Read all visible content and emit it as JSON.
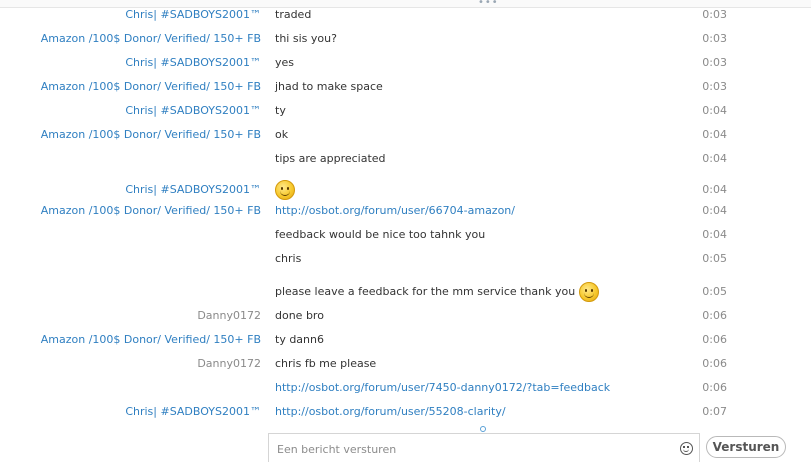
{
  "messages": [
    {
      "sender": "Chris| #SADBOYS2001™",
      "sender_style": "blue",
      "text": "traded",
      "time": "0:03"
    },
    {
      "sender": "Amazon /100$ Donor/ Verified/ 150+ FB",
      "sender_style": "blue",
      "text": "thi sis you?",
      "time": "0:03"
    },
    {
      "sender": "Chris| #SADBOYS2001™",
      "sender_style": "blue",
      "text": "yes",
      "time": "0:03"
    },
    {
      "sender": "Amazon /100$ Donor/ Verified/ 150+ FB",
      "sender_style": "blue",
      "text": "jhad to make space",
      "time": "0:03"
    },
    {
      "sender": "Chris| #SADBOYS2001™",
      "sender_style": "blue",
      "text": "ty",
      "time": "0:04"
    },
    {
      "sender": "Amazon /100$ Donor/ Verified/ 150+ FB",
      "sender_style": "blue",
      "text": "ok",
      "time": "0:04"
    },
    {
      "sender": "",
      "sender_style": "blue",
      "text": "tips are appreciated",
      "time": "0:04"
    },
    {
      "sender": "Chris| #SADBOYS2001™",
      "sender_style": "blue",
      "text": "",
      "emoji": "smile-emoji",
      "time": "0:04"
    },
    {
      "sender": "Amazon /100$ Donor/ Verified/ 150+ FB",
      "sender_style": "blue",
      "text": "http://osbot.org/forum/user/66704-amazon/",
      "link": true,
      "time": "0:04"
    },
    {
      "sender": "",
      "sender_style": "blue",
      "text": "feedback would be nice too tahnk you",
      "time": "0:04"
    },
    {
      "sender": "",
      "sender_style": "blue",
      "text": "chris",
      "time": "0:05"
    },
    {
      "sender": "",
      "sender_style": "blue",
      "text": "please leave a feedback for the mm service thank you",
      "emoji": "smile-emoji",
      "time": "0:05"
    },
    {
      "sender": "Danny0172",
      "sender_style": "gray",
      "text": "done bro",
      "time": "0:06"
    },
    {
      "sender": "Amazon /100$ Donor/ Verified/ 150+ FB",
      "sender_style": "blue",
      "text": "ty dann6",
      "time": "0:06"
    },
    {
      "sender": "Danny0172",
      "sender_style": "gray",
      "text": "chris fb me please",
      "time": "0:06"
    },
    {
      "sender": "",
      "sender_style": "blue",
      "text": "http://osbot.org/forum/user/7450-danny0172/?tab=feedback",
      "link": true,
      "time": "0:06"
    },
    {
      "sender": "Chris| #SADBOYS2001™",
      "sender_style": "blue",
      "text": "http://osbot.org/forum/user/55208-clarity/",
      "link": true,
      "time": "0:07"
    }
  ],
  "composer": {
    "placeholder": "Een bericht versturen",
    "value": "",
    "emoji_icon": "smile-icon",
    "send_label": "Versturen"
  },
  "colors": {
    "link": "#2f7fc1",
    "sender_blue": "#2f7fc1",
    "sender_gray": "#8a8a8a",
    "time": "#8a8a8a"
  }
}
